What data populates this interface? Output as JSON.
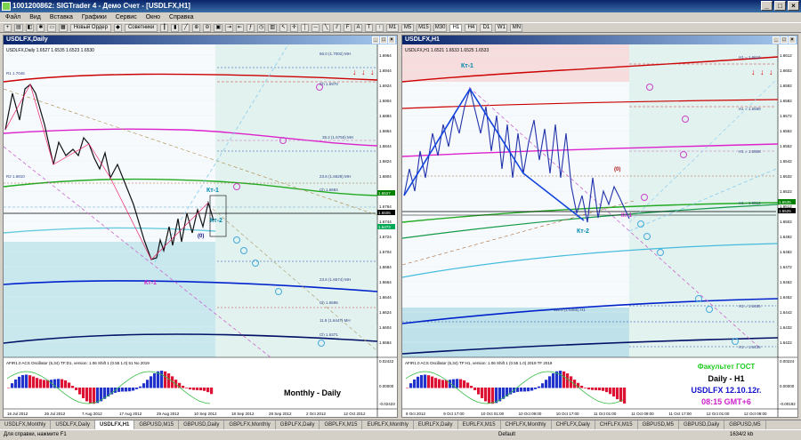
{
  "app": {
    "title": "1001200862: SIGTrader 4 - Демо Счет - [USDLFX,H1]"
  },
  "menu": [
    "Файл",
    "Вид",
    "Вставка",
    "Графики",
    "Сервис",
    "Окно",
    "Справка"
  ],
  "toolbar": {
    "new_order": "Новый Ордер",
    "experts": "Советники",
    "timeframes": [
      "M1",
      "M5",
      "M15",
      "M30",
      "H1",
      "H4",
      "D1",
      "W1",
      "MN"
    ]
  },
  "left_panel": {
    "title": "USDLFX,Daily",
    "ohlc": "USDLFX,Daily 1.6527 1.6535 1.6523 1.6530",
    "price_labels": [
      "1.6964",
      "1.6944",
      "1.6924",
      "1.6904",
      "1.6884",
      "1.6864",
      "1.6844",
      "1.6824",
      "1.6804",
      "1.6784",
      "1.6764",
      "1.6744",
      "1.6724",
      "1.6704",
      "1.6684",
      "1.6664",
      "1.6644",
      "1.6624",
      "1.6604",
      "1.6584"
    ],
    "price_tags": [
      {
        "label": "1.6527",
        "color": "#008000"
      },
      {
        "label": "1.6505",
        "color": "#000000"
      },
      {
        "label": "1.6473",
        "color": "#00aa55"
      }
    ],
    "fibo": [
      "R1 1.7046",
      "Ch 1.6970",
      "R2 1.6810",
      "66.0 (1.7002) MH",
      "38.2 (1.6750) MH",
      "23.6 (1.6628) MH",
      "Ch 1.6684",
      "23.6 (1.6574) MH",
      "Ch 1.6596",
      "11.8 (1.6447) MH",
      "Ch 1.6371"
    ],
    "labels": {
      "kt1": "Кт-1",
      "kt2": "Кт-2",
      "kt_1": "Кт-1",
      "zero": "(0)"
    },
    "osc_header": "AFIR1.0 ACS Oscillator (5,34) TF:D1, version: 1.06 Shift 1 (0.55 1.0) 51 No 2019",
    "osc_scale": [
      "0.02422",
      "0.00000",
      "-0.02423"
    ],
    "dates": [
      "16 Jul 2012",
      "26 Jul 2012",
      "7 Aug 2012",
      "17 Aug 2012",
      "29 Aug 2012",
      "10 Sep 2012",
      "18 Sep 2012",
      "28 Sep 2012",
      "2 Oct 2012",
      "12 Oct 2012"
    ],
    "caption": "Monthly - Daily"
  },
  "right_panel": {
    "title": "USDLFX,H1",
    "ohlc": "USDLFX,H1 1.6521 1.6533 1.6525 1.6533",
    "price_labels": [
      "1.6612",
      "1.6602",
      "1.6592",
      "1.6582",
      "1.6572",
      "1.6562",
      "1.6552",
      "1.6542",
      "1.6532",
      "1.6522",
      "1.6512",
      "1.6502",
      "1.6492",
      "1.6482",
      "1.6472",
      "1.6462",
      "1.6452",
      "1.6442",
      "1.6432",
      "1.6422"
    ],
    "price_tags": [
      {
        "label": "1.6535",
        "color": "#008000"
      },
      {
        "label": "1.6525",
        "color": "#000000"
      }
    ],
    "fibo": [
      "H1 = 1.6619",
      "H1 = 1.6589",
      "H1 = 1.6558",
      "H1 = 1.6512",
      "H1 = 1.6465",
      "H1 = 1.6435",
      "111.8 (1.6465) H1"
    ],
    "labels": {
      "kt1": "Кт-1",
      "kt2": "Кт-2",
      "kt_1": "Кт-1",
      "zero": "(0)"
    },
    "osc_header": "AFIR1.0 ACS Oscillator (5,34) TF:H1, version: 1.06 Shift 1 (0.55 1.0) 2019 TF 2019",
    "osc_scale": [
      "0.00224",
      "0.00000",
      "-0.00192"
    ],
    "dates": [
      "9 Oct 2012",
      "9 Oct 17:00",
      "10 Oct 01:00",
      "10 Oct 09:00",
      "10 Oct 17:00",
      "11 Oct 01:00",
      "11 Oct 09:00",
      "11 Oct 17:00",
      "12 Oct 01:00",
      "12 Oct 09:00"
    ],
    "caption": {
      "line1": "Факультет ГОСТ",
      "line2": "Daily - H1",
      "line3": "USDLFX 12.10.12г.",
      "line4": "08:15  GMT+6"
    }
  },
  "tabs": [
    "USDLFX,Monthly",
    "USDLFX,Daily",
    "USDLFX,H1",
    "GBPUSD,M15",
    "GBPUSD,Daily",
    "GBPLFX,Monthly",
    "GBPLFX,Daily",
    "GBPLFX,M15",
    "EURLFX,Monthly",
    "EURLFX,Daily",
    "EURLFX,M15",
    "CHFLFX,Monthly",
    "CHFLFX,Daily",
    "CHFLFX,M15",
    "GBPUSD,M5",
    "GBPUSD,Daily",
    "GBPUSD,M5"
  ],
  "active_tab": 2,
  "status": {
    "help": "Для справки, нажмите F1",
    "profile": "Default",
    "traffic": "1634/2 kb"
  }
}
